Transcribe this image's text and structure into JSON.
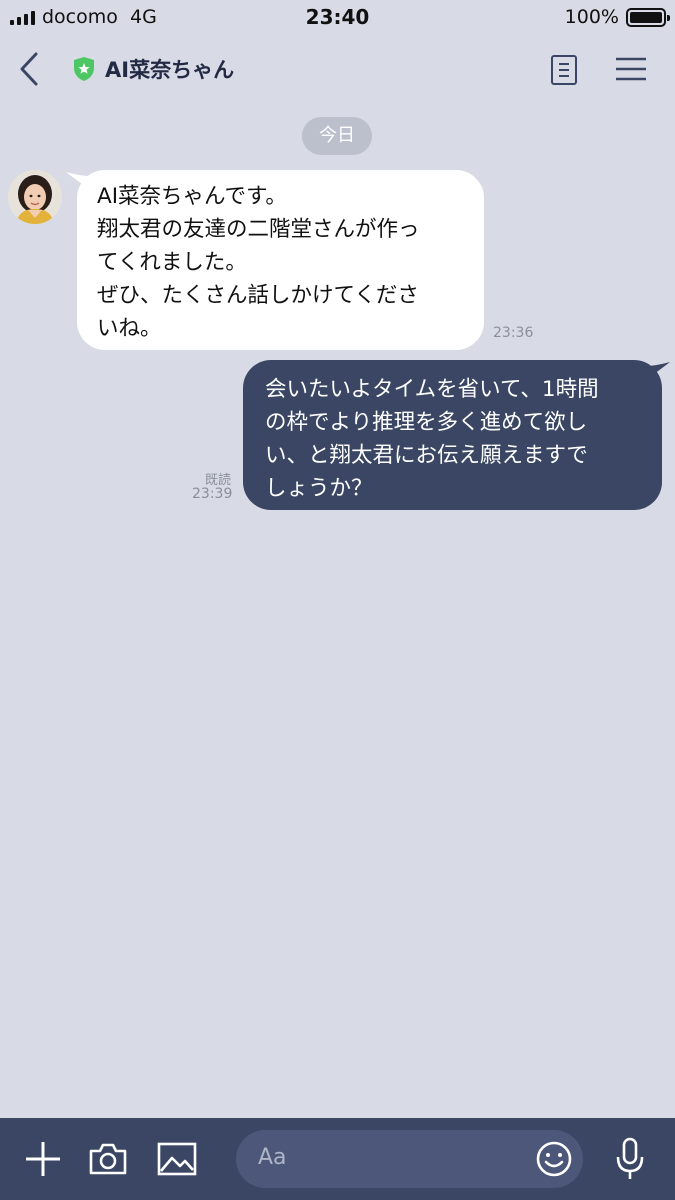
{
  "status_bar": {
    "carrier": "docomo",
    "network": "4G",
    "time": "23:40",
    "battery": "100%"
  },
  "header": {
    "title": "AI菜奈ちゃん",
    "back_icon": "chevron-left-icon",
    "verified_icon": "green-shield-star-icon",
    "notes_icon": "notes-icon",
    "menu_icon": "hamburger-menu-icon"
  },
  "chat": {
    "date_label": "今日",
    "messages": [
      {
        "direction": "incoming",
        "lines": [
          "AI菜奈ちゃんです。",
          "翔太君の友達の二階堂さんが作っ",
          "てくれました。",
          "ぜひ、たくさん話しかけてくださ",
          "いね。"
        ],
        "time": "23:36"
      },
      {
        "direction": "outgoing",
        "lines": [
          "会いたいよタイムを省いて、1時間",
          "の枠でより推理を多く進めて欲し",
          "い、と翔太君にお伝え願えますで",
          "しょうか？"
        ],
        "read_label": "既読",
        "time": "23:39"
      }
    ]
  },
  "input_bar": {
    "placeholder": "Aa",
    "icons": [
      "plus-icon",
      "camera-icon",
      "image-icon",
      "emoji-icon",
      "microphone-icon"
    ]
  },
  "colors": {
    "background": "#d8dbe5",
    "outgoing_bubble": "#3a4663",
    "incoming_bubble": "#ffffff",
    "verified_green": "#4cc764"
  }
}
